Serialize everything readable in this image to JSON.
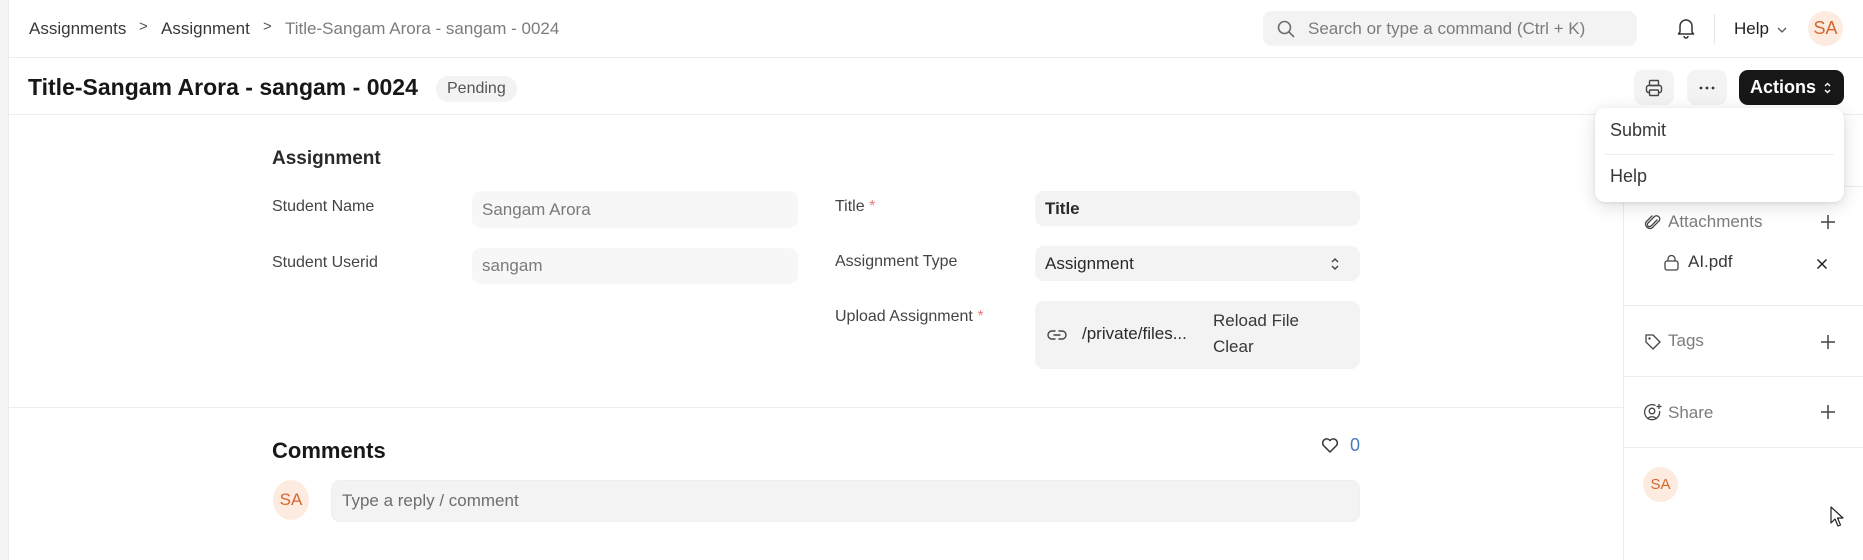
{
  "navbar": {
    "breadcrumbs": [
      {
        "label": "Assignments"
      },
      {
        "label": "Assignment"
      },
      {
        "label": "Title-Sangam Arora - sangam - 0024"
      }
    ],
    "breadcrumb_separator": ">",
    "search_placeholder": "Search or type a command (Ctrl + K)",
    "help_label": "Help",
    "user_initials": "SA",
    "icons": {
      "search": "search-icon",
      "notifications": "bell-icon",
      "help_dropdown": "chevron-down-icon"
    }
  },
  "page": {
    "title": "Title-Sangam Arora - sangam - 0024",
    "status": "Pending",
    "actions_label": "Actions",
    "icons": {
      "print": "printer-icon",
      "more": "ellipsis-icon",
      "actions": "chevron-up-down-icon"
    }
  },
  "actions_menu": {
    "items": [
      {
        "label": "Submit"
      },
      {
        "label": "Help"
      }
    ]
  },
  "form": {
    "section_title": "Assignment",
    "fields": {
      "student_name": {
        "label": "Student Name",
        "value": "Sangam Arora",
        "read_only": true
      },
      "student_userid": {
        "label": "Student Userid",
        "value": "sangam",
        "read_only": true
      },
      "title": {
        "label": "Title",
        "required_mark": "*",
        "value": "Title"
      },
      "assignment_type": {
        "label": "Assignment Type",
        "value": "Assignment"
      },
      "upload_assignment": {
        "label": "Upload Assignment",
        "required_mark": "*",
        "file_path": "/private/files...",
        "reload_label": "Reload File",
        "clear_label": "Clear"
      }
    }
  },
  "comments": {
    "title": "Comments",
    "likes_count": "0",
    "user_initials": "SA",
    "placeholder": "Type a reply / comment"
  },
  "sidebar": {
    "attachments": {
      "label": "Attachments",
      "files": [
        {
          "name": "AI.pdf"
        }
      ]
    },
    "tags": {
      "label": "Tags"
    },
    "share": {
      "label": "Share"
    },
    "viewer_initials": "SA"
  },
  "colors": {
    "accent_dark": "#171717",
    "avatar_bg": "#fdebe0",
    "avatar_text": "#d4662f",
    "required": "#e37f7f",
    "likes": "#4a7bbf"
  }
}
